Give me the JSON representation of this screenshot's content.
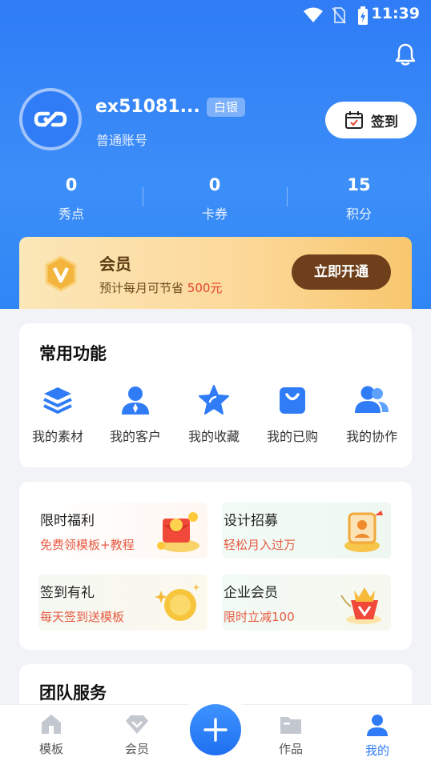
{
  "status_bar": {
    "time": "11:39"
  },
  "profile": {
    "username": "ex51081...",
    "tier_badge": "白银",
    "account_type": "普通账号",
    "signin_label": "签到"
  },
  "stats": [
    {
      "value": "0",
      "label": "秀点"
    },
    {
      "value": "0",
      "label": "卡券"
    },
    {
      "value": "15",
      "label": "积分"
    }
  ],
  "vip_banner": {
    "title": "会员",
    "desc_prefix": "预计每月可节省 ",
    "desc_amount": "500元",
    "button_label": "立即开通"
  },
  "common_functions": {
    "title": "常用功能",
    "items": [
      {
        "label": "我的素材",
        "icon": "layers-icon"
      },
      {
        "label": "我的客户",
        "icon": "customer-icon"
      },
      {
        "label": "我的收藏",
        "icon": "star-icon"
      },
      {
        "label": "我的已购",
        "icon": "shopping-bag-icon"
      },
      {
        "label": "我的协作",
        "icon": "collaboration-icon"
      }
    ]
  },
  "promos": [
    {
      "title": "限时福利",
      "subtitle": "免费领模板+教程",
      "icon": "free-gift-icon"
    },
    {
      "title": "设计招募",
      "subtitle": "轻松月入过万",
      "icon": "designer-icon"
    },
    {
      "title": "签到有礼",
      "subtitle": "每天签到送模板",
      "icon": "coin-icon"
    },
    {
      "title": "企业会员",
      "subtitle": "限时立减100",
      "icon": "enterprise-gift-icon"
    }
  ],
  "team_service": {
    "title": "团队服务"
  },
  "tabbar": [
    {
      "label": "模板",
      "icon": "home-icon"
    },
    {
      "label": "会员",
      "icon": "diamond-icon"
    },
    {
      "label": "作品",
      "icon": "folder-icon"
    },
    {
      "label": "我的",
      "icon": "user-icon",
      "active": true
    }
  ],
  "colors": {
    "primary": "#2f7cf6",
    "vip_button": "#6e3f1a",
    "promo_red": "#e65a42"
  }
}
